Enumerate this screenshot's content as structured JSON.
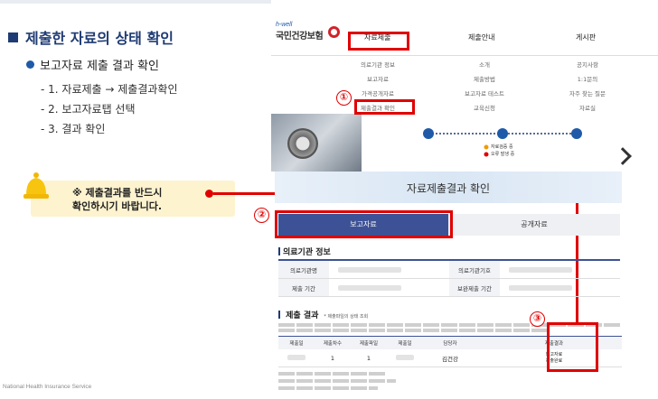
{
  "slide": {
    "heading": "제출한 자료의 상태 확인",
    "subheading": "보고자료 제출 결과 확인",
    "steps": [
      "- 1. 자료제출 → 제출결과확인",
      "- 2. 보고자료탭 선택",
      "- 3. 결과 확인"
    ],
    "notice_line1": "※ 제출결과를 반드시",
    "notice_line2": "확인하시기 바랍니다.",
    "footer": "National Health Insurance Service"
  },
  "site": {
    "logo_small": "h-well",
    "logo_name": "국민건강보험",
    "nav": [
      "자료제출",
      "제출안내",
      "게시판"
    ],
    "menu_col1": [
      "의료기관 정보",
      "보고자료",
      "가격공개자료",
      "제출결과 확인"
    ],
    "menu_col2": [
      "소개",
      "제출방법",
      "보고자료 테스트",
      "교육신청"
    ],
    "menu_col3": [
      "공지사항",
      "1:1문의",
      "자주 찾는 질문",
      "자료실"
    ],
    "legend": [
      "자료검증 중",
      "오류 발생 중"
    ],
    "results_title": "자료제출결과 확인",
    "tab_report": "보고자료",
    "tab_public": "공개자료",
    "section_institution": "의료기관 정보",
    "labels": [
      "의료기관명",
      "의료기관기호",
      "제출 기간",
      "보완제출 기간"
    ],
    "section_results": "제출 결과",
    "results_note": "* 제출파일의 상태 조회",
    "result_headers": [
      "제출일",
      "제출차수",
      "제출파일",
      "제출일",
      "담당자",
      "제출결과"
    ],
    "result_row_count": "1",
    "result_row_count2": "1",
    "result_name": "김건강",
    "result_status1": "보고자료",
    "result_status2": "제출완료"
  },
  "annotations": [
    "①",
    "②",
    "③"
  ],
  "colors": {
    "accent": "#1f3b73",
    "annotation": "#e00000",
    "tab_active": "#3d5296",
    "notice_bg": "#fdf3cf"
  }
}
